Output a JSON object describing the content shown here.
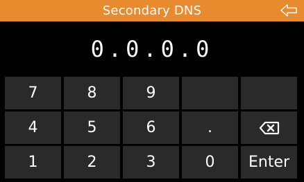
{
  "header": {
    "title": "Secondary DNS",
    "back_icon": "back-arrow-icon",
    "bar_color": "#e88a2e"
  },
  "display": {
    "value": "0.0.0.0"
  },
  "keypad": {
    "key_7": "7",
    "key_8": "8",
    "key_9": "9",
    "key_4": "4",
    "key_5": "5",
    "key_6": "6",
    "key_dot": ".",
    "backspace_icon": "backspace-icon",
    "key_1": "1",
    "key_2": "2",
    "key_3": "3",
    "key_0": "0",
    "key_enter": "Enter",
    "key_color": "#2a2a2a"
  }
}
